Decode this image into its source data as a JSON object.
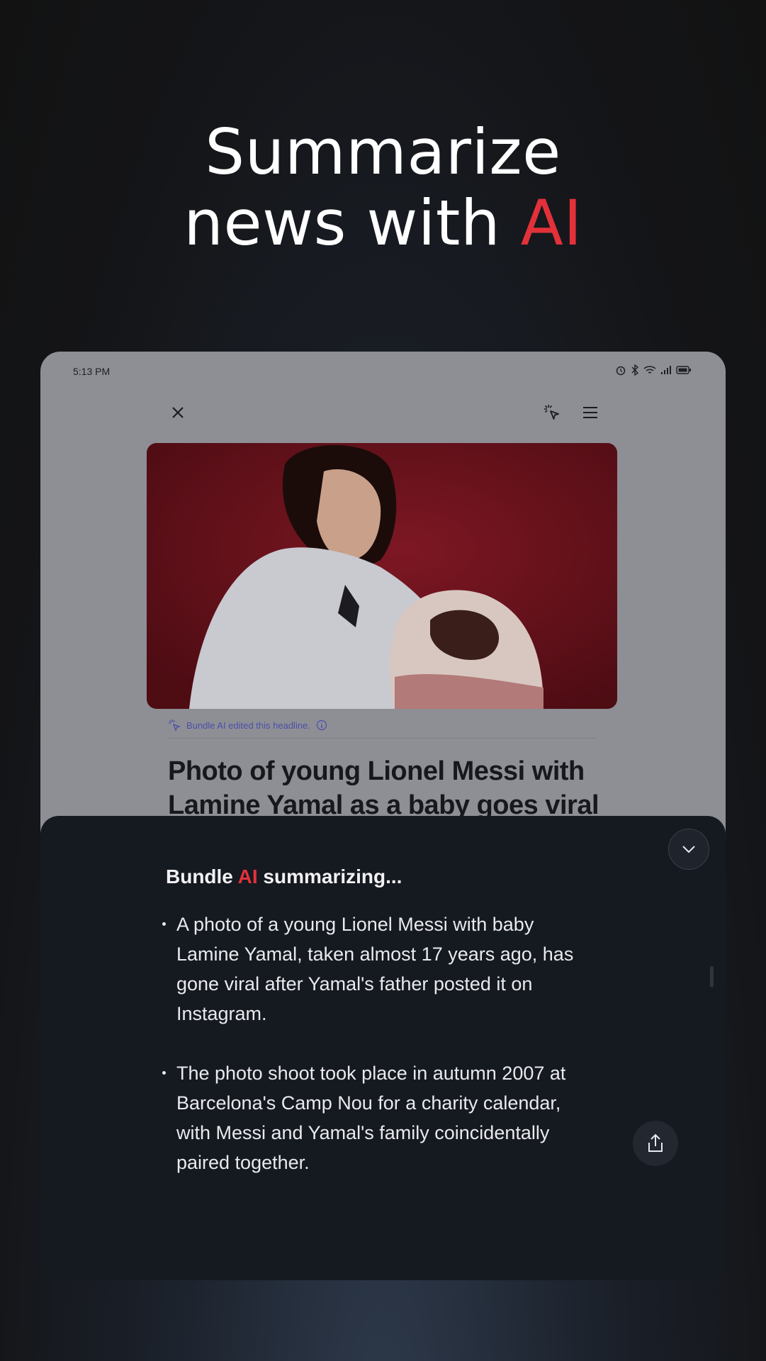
{
  "hero": {
    "line1": "Summarize",
    "line2_prefix": "news with ",
    "line2_accent": "AI"
  },
  "status_bar": {
    "time": "5:13 PM",
    "icons": [
      "alarm-icon",
      "bluetooth-icon",
      "wifi-icon",
      "signal-icon",
      "battery-icon"
    ]
  },
  "toolbar": {
    "close_icon": "close-icon",
    "ai_icon": "ai-sparkle-cursor-icon",
    "menu_icon": "hamburger-menu-icon"
  },
  "article": {
    "ai_note": "Bundle AI edited this headline.",
    "headline": "Photo of young Lionel Messi with Lamine Yamal as a baby goes viral"
  },
  "summary": {
    "title_prefix": "Bundle ",
    "title_accent": "AI",
    "title_suffix": " summarizing...",
    "bullets": [
      "A photo of a young Lionel Messi with baby Lamine Yamal, taken almost 17 years ago, has gone viral after Yamal's father posted it on Instagram.",
      "The photo shoot took place in autumn 2007 at Barcelona's Camp Nou for a charity calendar, with Messi and Yamal's family coincidentally paired together."
    ]
  },
  "colors": {
    "accent": "#e3313a",
    "sheet_bg": "#151920",
    "ai_note": "#4b4fa8"
  }
}
